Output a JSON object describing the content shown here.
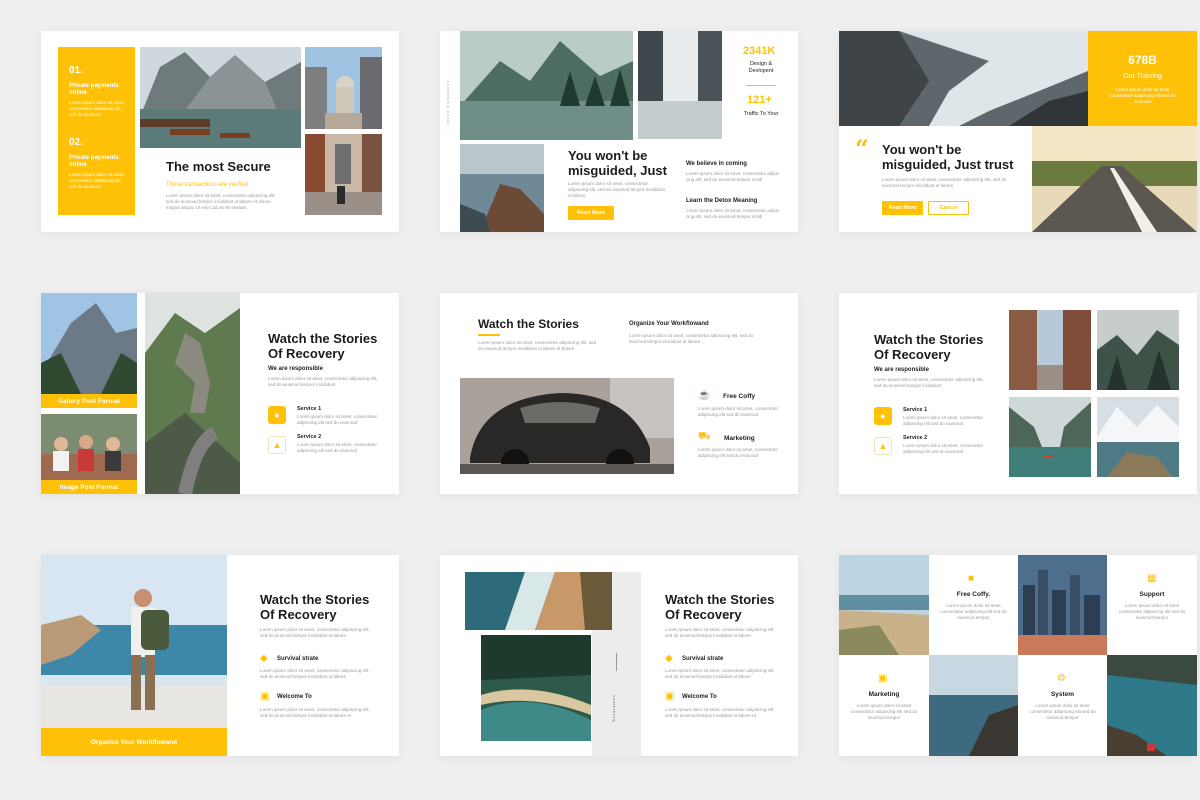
{
  "slide1": {
    "num1": "01.",
    "item1": "Private payments online",
    "num2": "02.",
    "item2": "Private payments online",
    "title": "The most Secure",
    "subtitle": "These transactions are verified",
    "body": "Lorem ipsum dolor sit amet, consectetur adipiscing elit, sed do eiusmod tempor incididunt ut labore et dolore magna aliqua. Ut enim ad minim veniam.",
    "list_body": "Lorem ipsum dolor sit amet, consectetur adipiscing elit, sed do eiusmod"
  },
  "slide2": {
    "stat1_value": "2341K",
    "stat1_label": "Design & Devlopent",
    "stat2_value": "121+",
    "stat2_label": "Traffic To Your",
    "title": "You won't be misguided, Just",
    "body": "Lorem ipsum dolor sit amet, consectetur adipiscing elit, sed do eiusmod tempor incididunt ut labore",
    "button": "Read More",
    "h1": "We believe in coming",
    "h1_body": "Lorem ipsum dolor sit amet, consectetur adipis cing elit, sed do eiusmod tempor incidi",
    "h2": "Learn the Detox Meaning",
    "h2_body": "Lorem ipsum dolor sit amet, consectetur adipis cing elit, sed do eiusmod tempor incidi",
    "vertical": "something about ..."
  },
  "slide3": {
    "stat_value": "678B",
    "stat_label": "Our Training",
    "stat_body": "Lorem ipsum dolor sit amet consectetur adipiscing elit sed do eiusmod",
    "quote": "“",
    "title": "You won't be misguided, Just trust",
    "body": "Lorem ipsum dolor sit amet, consectetur adipiscing elit, sed do eiusmod tempor incididunt ut labore",
    "button1": "Read More",
    "button2": "Cancel"
  },
  "slide4": {
    "cap1": "Gallery Post Format",
    "cap2": "Image Post Format",
    "title": "Watch the Stories Of Recovery",
    "sub": "We are responsible",
    "body": "Lorem ipsum dolor sit amet, consectetur adipiscing elit, sed do eiusmod tempor incididunt",
    "service1": "Service 1",
    "service1_body": "Lorem ipsum dolor sit amet, consectetur adipiscing elit sed do eiusmod",
    "service2": "Service 2",
    "service2_body": "Lorem ipsum dolor sit amet, consectetur adipiscing elit sed do eiusmod"
  },
  "slide5": {
    "title": "Watch the Stories",
    "body": "Lorem ipsum dolor sit amet, consectetur adipiscing elit, sed do eiusmod tempor incididunt ut labore et dolore",
    "right_title": "Organize Your Workflowand",
    "right_body": "Lorem ipsum dolor sit amet, consectetur adipiscing elit, sed do eiusmod tempor incididunt ut labore",
    "f1": "Free Coffy",
    "f1_body": "Lorem ipsum dolor sit amet, consectetur adipiscing elit sed do eiusmod",
    "f2": "Marketing",
    "f2_body": "Lorem ipsum dolor sit amet, consectetur adipiscing elit sed do eiusmod"
  },
  "slide6": {
    "title": "Watch the Stories Of Recovery",
    "sub": "We are responsible",
    "body": "Lorem ipsum dolor sit amet, consectetur adipiscing elit, sed do eiusmod tempor incididunt",
    "service1": "Service 1",
    "service1_body": "Lorem ipsum dolor sit amet, consectetur adipiscing elit sed do eiusmod",
    "service2": "Service 2",
    "service2_body": "Lorem ipsum dolor sit amet, consectetur adipiscing elit sed do eiusmod"
  },
  "slide7": {
    "caption": "Organize Your Workflowand",
    "title": "Watch the Stories Of Recovery",
    "body": "Lorem ipsum dolor sit amet, consectetur adipiscing elit, sed do eiusmod tempor incididunt ut labore",
    "f1": "Survival strate",
    "f1_body": "Lorem ipsum dolor sit amet, consectetur adipiscing elit, sed do eiusmod tempor incididunt ut labore",
    "f2": "Welcome To",
    "f2_body": "Lorem ipsum dolor sit amet, consectetur adipiscing elit, sed do eiusmod tempor incididunt ut labore et"
  },
  "slide8": {
    "vertical": "something",
    "title": "Watch the Stories Of Recovery",
    "body": "Lorem ipsum dolor sit amet, consectetur adipiscing elit, sed do eiusmod tempor incididunt ut labore",
    "f1": "Survival strate",
    "f1_body": "Lorem ipsum dolor sit amet, consectetur adipiscing elit, sed do eiusmod tempor incididunt ut labore",
    "f2": "Welcome To",
    "f2_body": "Lorem ipsum dolor sit amet, consectetur adipiscing elit, sed do eiusmod tempor incididunt ut labore et"
  },
  "slide9": {
    "c1": "Free Coffy.",
    "c1_body": "Lorem ipsum dolor sit amet consectetur adipiscing elit sed do eiusmod tempor",
    "c2": "Support",
    "c2_body": "Lorem ipsum dolor sit amet consectetur adipiscing elit sed do eiusmod tempor",
    "c3": "Marketing",
    "c3_body": "Lorem ipsum dolor sit amet consectetur adipiscing elit sed do eiusmod tempor",
    "c4": "System",
    "c4_body": "Lorem ipsum dolor sit amet consectetur adipiscing elit sed do eiusmod tempor"
  },
  "colors": {
    "accent": "#FFC107",
    "background": "#efefef"
  }
}
